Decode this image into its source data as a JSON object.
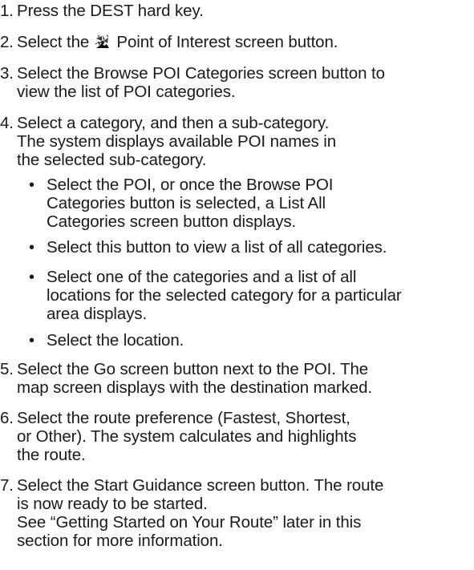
{
  "steps": [
    {
      "number": "1.",
      "lines": [
        "Press the DEST hard key."
      ]
    },
    {
      "number": "2.",
      "before_icon": "Select the",
      "icon": "point-of-interest-icon",
      "after_icon": "Point of Interest screen button."
    },
    {
      "number": "3.",
      "lines": [
        "Select the Browse POI Categories screen button to",
        "view the list of POI categories."
      ]
    },
    {
      "number": "4.",
      "lines": [
        "Select a category, and then a sub-category.",
        "The system displays available POI names in",
        "the selected sub-category."
      ]
    },
    {
      "number": "5.",
      "lines": [
        "Select the Go screen button next to the POI. The",
        "map screen displays with the destination marked."
      ]
    },
    {
      "number": "6.",
      "lines": [
        "Select the route preference (Fastest, Shortest,",
        "or Other). The system calculates and highlights",
        "the route."
      ]
    },
    {
      "number": "7.",
      "lines": [
        "Select the Start Guidance screen button. The route",
        "is now ready to be started.",
        "See “Getting Started on Your Route” later in this",
        "section for more information."
      ]
    }
  ],
  "sub_bullets": [
    {
      "lines": [
        "Select the POI, or once the Browse POI",
        "Categories button is selected, a List All",
        "Categories screen button displays."
      ]
    },
    {
      "lines": [
        "Select this button to view a list of all categories."
      ]
    },
    {
      "lines": [
        "Select one of the categories and a list of all",
        "locations for the selected category for a particular",
        "area displays."
      ]
    },
    {
      "lines": [
        "Select the location."
      ]
    }
  ]
}
